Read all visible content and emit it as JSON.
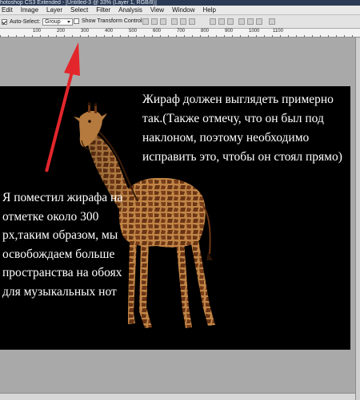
{
  "window": {
    "title_fragment": "hotoshop CS3 Extended - [Untitled-3 @ 33% (Layer 1, RGB/8)]"
  },
  "menu": [
    "Edit",
    "Image",
    "Layer",
    "Select",
    "Filter",
    "Analysis",
    "View",
    "Window",
    "Help"
  ],
  "options_bar": {
    "auto_select_label": "Auto-Select:",
    "auto_select_checked": true,
    "auto_select_value": "Group",
    "transform_label": "Show Transform Controls",
    "transform_checked": false
  },
  "ruler": {
    "ticks": [
      "100",
      "200",
      "300",
      "400",
      "500",
      "600",
      "700",
      "800",
      "900",
      "1000",
      "1100"
    ]
  },
  "annotations": {
    "top_text": "Жираф должен выглядеть примерно так.(Также отмечу, что он был под наклоном, поэтому необходимо исправить это, чтобы он стоял прямо)",
    "left_text": "Я поместил жирафа на отметке около 300 px,таким образом, мы освобождаем больше пространства на обоях для музыкальных нот"
  },
  "colors": {
    "arrow": "#e3262b",
    "canvas": "#000000",
    "giraffe_base": "#b5783e",
    "giraffe_patch": "#6a3515"
  }
}
